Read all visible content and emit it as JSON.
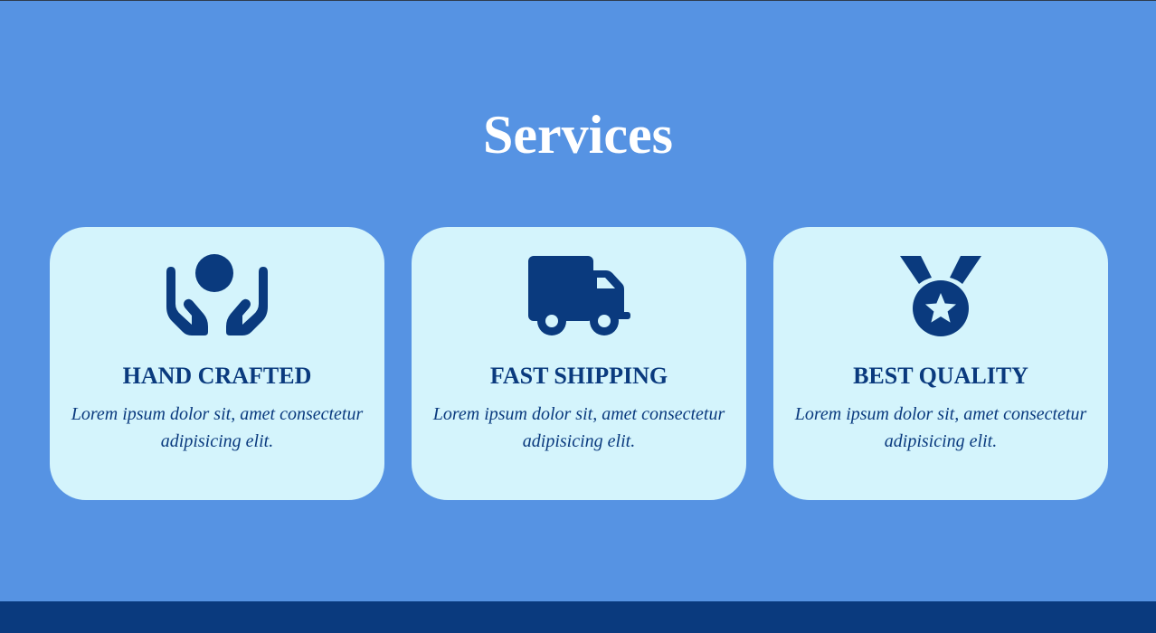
{
  "section": {
    "title": "Services"
  },
  "cards": [
    {
      "icon": "hands-holding-circle-icon",
      "title": "HAND CRAFTED",
      "description": "Lorem ipsum dolor sit, amet consectetur adipisicing elit."
    },
    {
      "icon": "truck-icon",
      "title": "FAST SHIPPING",
      "description": "Lorem ipsum dolor sit, amet consectetur adipisicing elit."
    },
    {
      "icon": "medal-icon",
      "title": "BEST QUALITY",
      "description": "Lorem ipsum dolor sit, amet consectetur adipisicing elit."
    }
  ],
  "colors": {
    "background": "#5693e3",
    "card": "#d4f4fc",
    "accent": "#0a3a7e",
    "title": "#ffffff"
  }
}
